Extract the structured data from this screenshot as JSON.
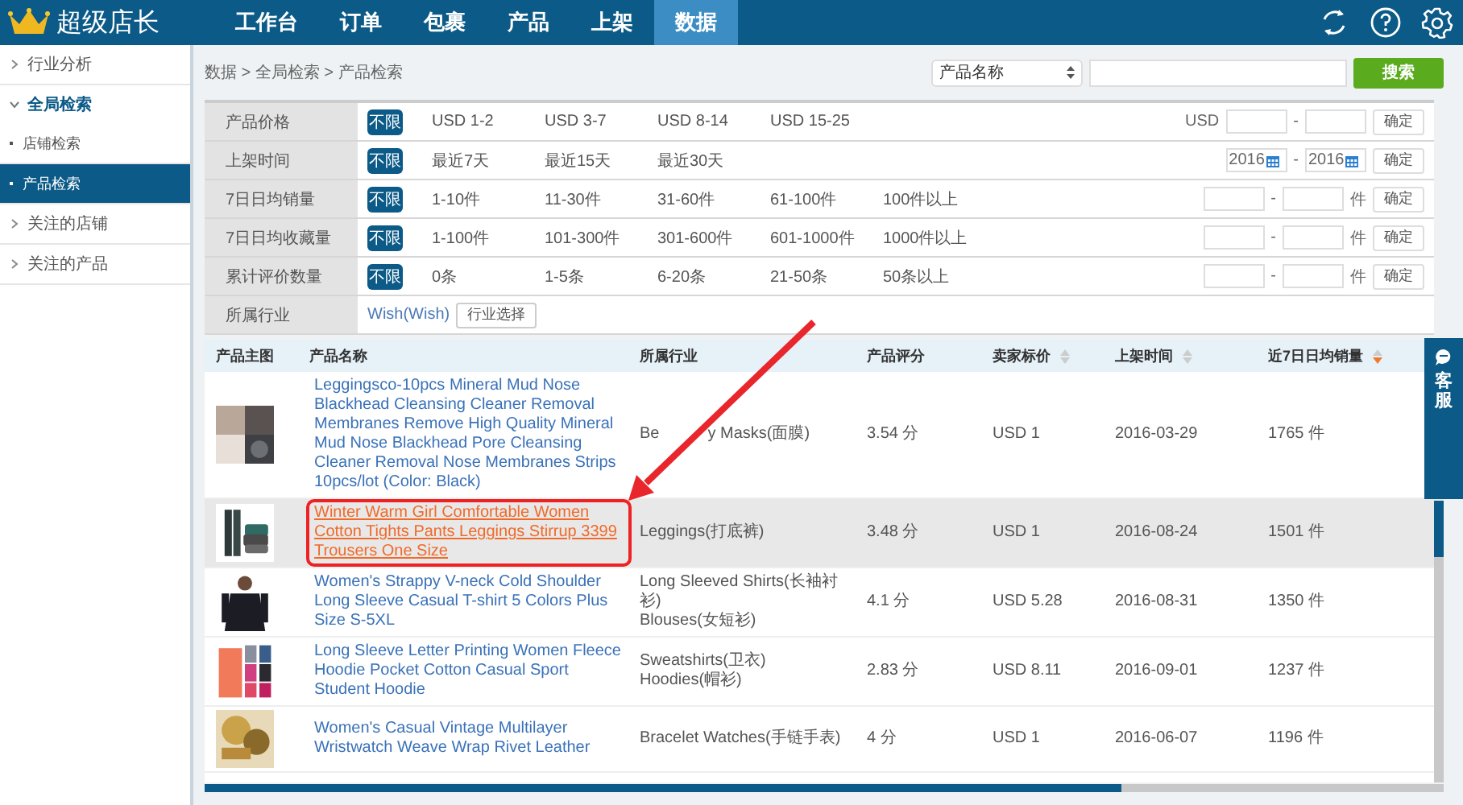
{
  "app": {
    "title": "超级店长"
  },
  "nav": [
    {
      "label": "工作台",
      "selected": false
    },
    {
      "label": "订单",
      "selected": false
    },
    {
      "label": "包裹",
      "selected": false
    },
    {
      "label": "产品",
      "selected": false
    },
    {
      "label": "上架",
      "selected": false
    },
    {
      "label": "数据",
      "selected": true
    }
  ],
  "sidebar": {
    "items": [
      {
        "label": "行业分析",
        "expanded": false
      },
      {
        "label": "全局检索",
        "expanded": true,
        "children": [
          {
            "label": "店铺检索",
            "selected": false
          },
          {
            "label": "产品检索",
            "selected": true
          }
        ]
      },
      {
        "label": "关注的店铺",
        "expanded": false
      },
      {
        "label": "关注的产品",
        "expanded": false
      }
    ]
  },
  "breadcrumb": "数据 > 全局检索 > 产品检索",
  "search": {
    "field": "产品名称",
    "button": "搜索"
  },
  "filters": [
    {
      "label": "产品价格",
      "options": [
        {
          "label": "不限",
          "selected": true
        },
        {
          "label": "USD 1-2",
          "selected": false
        },
        {
          "label": "USD 3-7",
          "selected": false
        },
        {
          "label": "USD 8-14",
          "selected": false
        },
        {
          "label": "USD 15-25",
          "selected": false
        }
      ],
      "range": {
        "kind": "usd",
        "prefix": "USD",
        "separator": "-",
        "confirm": "确定"
      }
    },
    {
      "label": "上架时间",
      "options": [
        {
          "label": "不限",
          "selected": true
        },
        {
          "label": "最近7天",
          "selected": false
        },
        {
          "label": "最近15天",
          "selected": false
        },
        {
          "label": "最近30天",
          "selected": false
        }
      ],
      "range": {
        "kind": "date",
        "from": "2016",
        "to": "2016",
        "separator": "-",
        "confirm": "确定"
      }
    },
    {
      "label": "7日日均销量",
      "options": [
        {
          "label": "不限",
          "selected": true
        },
        {
          "label": "1-10件",
          "selected": false
        },
        {
          "label": "11-30件",
          "selected": false
        },
        {
          "label": "31-60件",
          "selected": false
        },
        {
          "label": "61-100件",
          "selected": false
        },
        {
          "label": "100件以上",
          "selected": false
        }
      ],
      "range": {
        "kind": "count",
        "separator": "-",
        "suffix": "件",
        "confirm": "确定"
      }
    },
    {
      "label": "7日日均收藏量",
      "options": [
        {
          "label": "不限",
          "selected": true
        },
        {
          "label": "1-100件",
          "selected": false
        },
        {
          "label": "101-300件",
          "selected": false
        },
        {
          "label": "301-600件",
          "selected": false
        },
        {
          "label": "601-1000件",
          "selected": false
        },
        {
          "label": "1000件以上",
          "selected": false
        }
      ],
      "range": {
        "kind": "count",
        "separator": "-",
        "suffix": "件",
        "confirm": "确定"
      }
    },
    {
      "label": "累计评价数量",
      "options": [
        {
          "label": "不限",
          "selected": true
        },
        {
          "label": "0条",
          "selected": false
        },
        {
          "label": "1-5条",
          "selected": false
        },
        {
          "label": "6-20条",
          "selected": false
        },
        {
          "label": "21-50条",
          "selected": false
        },
        {
          "label": "50条以上",
          "selected": false
        }
      ],
      "range": {
        "kind": "count",
        "separator": "-",
        "suffix": "件",
        "confirm": "确定"
      }
    },
    {
      "label": "所属行业",
      "industry": {
        "value": "Wish(Wish)",
        "button": "行业选择"
      }
    }
  ],
  "table": {
    "columns": [
      {
        "label": "产品主图"
      },
      {
        "label": "产品名称"
      },
      {
        "label": "所属行业"
      },
      {
        "label": "产品评分"
      },
      {
        "label": "卖家标价",
        "sortable": true,
        "sorted": false
      },
      {
        "label": "上架时间",
        "sortable": true,
        "sorted": false
      },
      {
        "label": "近7日日均销量",
        "sortable": true,
        "sorted": true
      }
    ],
    "rows": [
      {
        "name": "Leggingsco-10pcs Mineral Mud Nose Blackhead Cleansing Cleaner Removal Membranes Remove High Quality Mineral Mud Nose Blackhead Pore Cleansing Cleaner Removal Nose Membranes Strips 10pcs/lot (Color: Black)",
        "industry_prefix": "Be",
        "industry": [
          "y Masks(面膜)"
        ],
        "rating": "3.54 分",
        "price": "USD 1",
        "date": "2016-03-29",
        "sales": "1765 件",
        "selected": false,
        "annotated": false
      },
      {
        "name": "Winter Warm Girl Comfortable Women Cotton Tights Pants Leggings Stirrup 3399 Trousers One Size",
        "industry": [
          "Leggings(打底裤)"
        ],
        "rating": "3.48 分",
        "price": "USD 1",
        "date": "2016-08-24",
        "sales": "1501 件",
        "selected": true,
        "annotated": true
      },
      {
        "name": "Women's Strappy V-neck Cold Shoulder Long Sleeve Casual T-shirt 5 Colors Plus Size S-5XL",
        "industry": [
          "Long Sleeved Shirts(长袖衬衫)",
          "Blouses(女短衫)"
        ],
        "rating": "4.1 分",
        "price": "USD 5.28",
        "date": "2016-08-31",
        "sales": "1350 件",
        "selected": false,
        "annotated": false
      },
      {
        "name": "Long Sleeve Letter Printing Women Fleece Hoodie Pocket Cotton Casual Sport Student Hoodie",
        "industry": [
          "Sweatshirts(卫衣)",
          "Hoodies(帽衫)"
        ],
        "rating": "2.83 分",
        "price": "USD 8.11",
        "date": "2016-09-01",
        "sales": "1237 件",
        "selected": false,
        "annotated": false
      },
      {
        "name": "Women's Casual Vintage Multilayer Wristwatch Weave Wrap Rivet Leather",
        "industry": [
          "Bracelet Watches(手链手表)"
        ],
        "rating": "4 分",
        "price": "USD 1",
        "date": "2016-06-07",
        "sales": "1196 件",
        "selected": false,
        "annotated": false
      }
    ]
  },
  "service_tab": {
    "label": "客服"
  }
}
